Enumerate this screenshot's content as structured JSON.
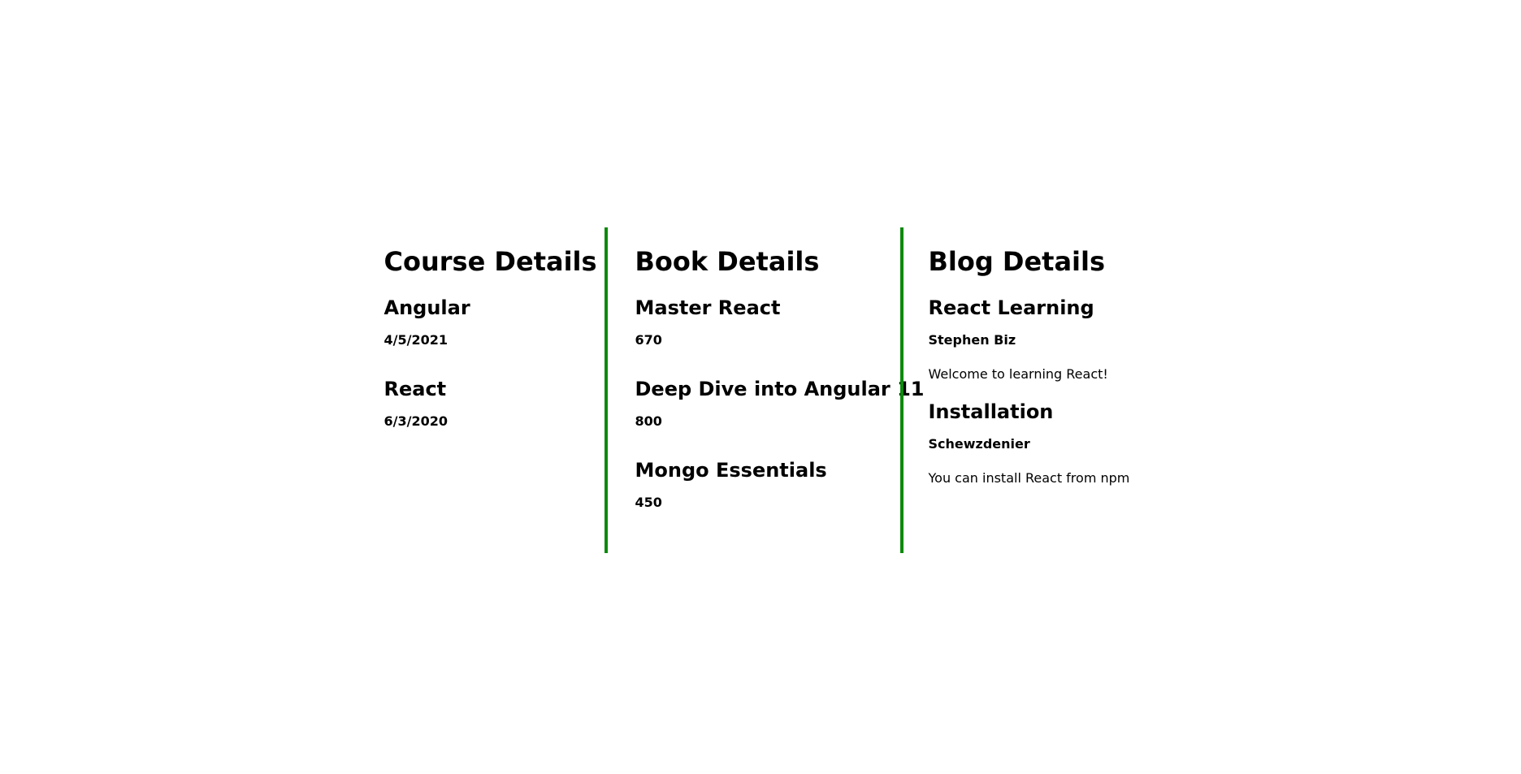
{
  "courses": {
    "heading": "Course Details",
    "items": [
      {
        "name": "Angular",
        "date": "4/5/2021"
      },
      {
        "name": "React",
        "date": "6/3/2020"
      }
    ]
  },
  "books": {
    "heading": "Book Details",
    "items": [
      {
        "name": "Master React",
        "price": "670"
      },
      {
        "name": "Deep Dive into Angular 11",
        "price": "800"
      },
      {
        "name": "Mongo Essentials",
        "price": "450"
      }
    ]
  },
  "blogs": {
    "heading": "Blog Details",
    "items": [
      {
        "title": "React Learning",
        "author": "Stephen Biz",
        "content": "Welcome to learning React!"
      },
      {
        "title": "Installation",
        "author": "Schewzdenier",
        "content": "You can install React from npm"
      }
    ]
  },
  "colors": {
    "divider": "#0c8a0c",
    "text": "#000000",
    "background": "#ffffff"
  }
}
